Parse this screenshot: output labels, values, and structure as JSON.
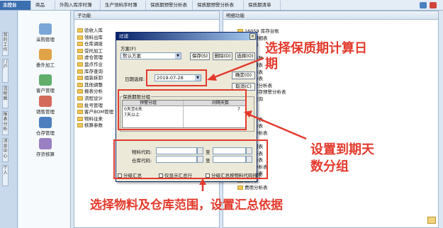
{
  "top_tabs": [
    "主控台",
    "商品",
    "外购入库序时簿",
    "生产领料序时簿",
    "保质期预警分析表",
    "保质期预警分析表",
    "保质期清单"
  ],
  "side_tabs": [
    "我的工作",
    "门户",
    "流程图",
    "报表分析",
    "消息中心",
    "个人"
  ],
  "nav_items": [
    "采购管理",
    "委外加工",
    "客户管理",
    "销售管理",
    "仓存管理",
    "存货核算"
  ],
  "subfunc_panel": {
    "title": "子功能",
    "items": [
      "验收入库",
      "领料出库",
      "仓库调拨",
      "受托加工",
      "虚仓管理",
      "盘点作业",
      "库存查询",
      "组装拆卸",
      "其他调整",
      "报表分析",
      "流程设计",
      "批号管理",
      "客户BOM管理",
      "物料往来",
      "核算参数"
    ]
  },
  "detail_panel": {
    "title": "明细功能",
    "items": [
      "16059 库存台账",
      "物流明细表",
      "汇总表",
      "账表",
      "库存台账",
      "存明细表",
      "存分析表",
      "龄分析表",
      "存预警分析表",
      "期限库存预警分析表",
      "批号查询",
      "清单",
      "C分析",
      "存分析表",
      "品分析表",
      "预警分析表",
      "报表",
      "次数据表",
      "数分析表",
      "滞分析表",
      "跟踪分析表",
      "额分析表",
      "统计表",
      "费用分析表"
    ]
  },
  "dialog": {
    "title": "过滤",
    "plan_label": "方案(F)",
    "plan_value": "默认方案",
    "buttons": {
      "save": "保存(S)",
      "delete": "删除(D)",
      "options": "选择(O)",
      "ok": "确定(O)",
      "cancel": "取消(C)"
    },
    "date_label": "日期选择:",
    "date_value": "2019-07-28",
    "group_title": "保质期限分组",
    "grid_headers": [
      "预警分组",
      "间隔天数"
    ],
    "grid_rows": [
      [
        "0天至6天",
        "7"
      ],
      [
        "7天以上",
        ""
      ]
    ],
    "material_label": "物料代码:",
    "warehouse_label": "仓库代码:",
    "to_label": "至",
    "checkboxes": [
      "分级汇总",
      "仅显示汇总行",
      "分级汇总按物料代码排序"
    ]
  },
  "annotations": {
    "date": "选择保质期计算日期",
    "group": "设置到期天数分组",
    "range": "选择物料及仓库范围，设置汇总依据"
  },
  "colors": {
    "annotation": "#e33a2c",
    "title_bar": "#0a246a",
    "active_tab": "#3c6fb0"
  }
}
